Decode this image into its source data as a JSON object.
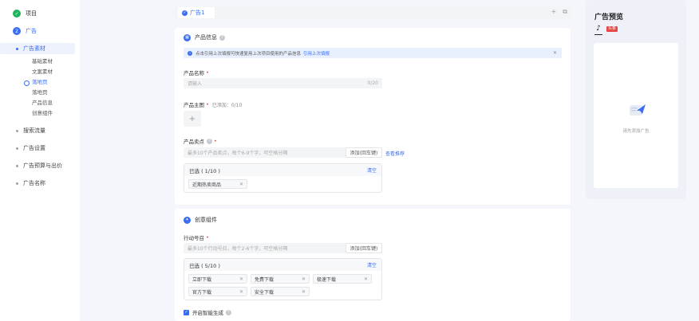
{
  "nav": {
    "steps": [
      {
        "label": "项目",
        "icon": "check"
      },
      {
        "label": "广告",
        "num": "2"
      }
    ],
    "sub": {
      "label": "广告素材",
      "leaves": [
        "基础素材",
        "文案素材",
        "落地页",
        "落地页",
        "产品信息",
        "创意组件"
      ]
    },
    "groups": [
      "搜索流量",
      "广告设置",
      "广告预算与出价",
      "广告名称"
    ]
  },
  "tabbar": {
    "tab_label": "广告1",
    "add_icon": "plus-icon",
    "copy_icon": "copy-icon"
  },
  "product": {
    "title": "产品信息",
    "notice_text": "点击引用上次填报可快速复用上次项目使用的产品信息",
    "notice_link": "引用上次填报",
    "name_label": "产品名称",
    "name_placeholder": "请输入",
    "name_count": "0/20",
    "image_label": "产品主图",
    "image_hint": "已添加：0/10",
    "selling_label": "产品卖点",
    "selling_placeholder": "最多10个产品卖点，每个6-9个字，可空格分隔",
    "selling_add": "添加(回车键)",
    "selling_link": "查看推荐",
    "picked_head": "已选 ( 1/10 )",
    "picked_clear": "清空",
    "picked_tags": [
      "近期热卖商品"
    ]
  },
  "creative": {
    "title": "创意组件",
    "action_label": "行动号召",
    "action_placeholder": "最多10个行动号召，每个2-6个字，可空格分隔",
    "action_add": "添加(回车键)",
    "picked_head": "已选 ( 5/10 )",
    "picked_clear": "清空",
    "picked_tags": [
      "立即下载",
      "免费下载",
      "极速下载",
      "官方下载",
      "安全下载"
    ],
    "smart_label": "开启智能生成"
  },
  "preview": {
    "title": "广告预览",
    "badge": "头条",
    "empty_text": "请先添加广告"
  },
  "colors": {
    "accent": "#3a6df0",
    "success": "#21b35f",
    "danger": "#e54545"
  }
}
